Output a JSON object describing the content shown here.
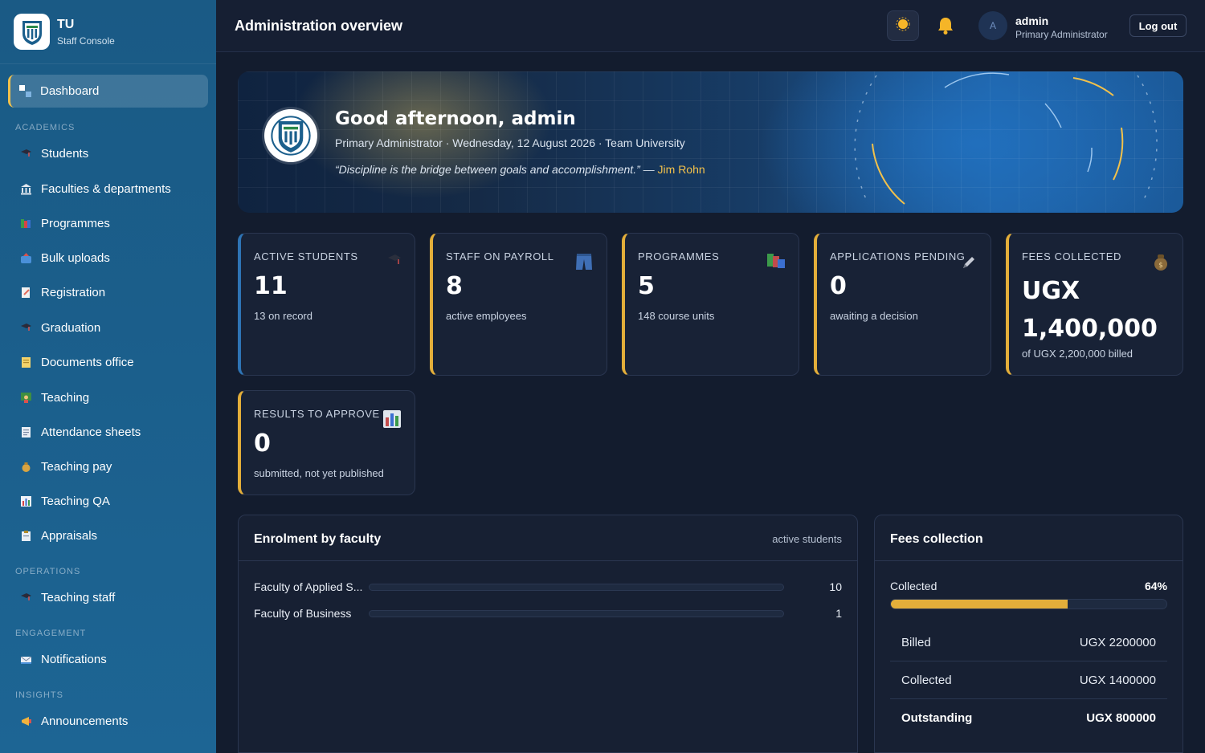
{
  "brand": {
    "name": "TU",
    "subtitle": "Staff Console"
  },
  "sidebar": {
    "active": {
      "label": "Dashboard",
      "icon": "dashboard-icon"
    },
    "sections": [
      {
        "title": "ACADEMICS",
        "items": [
          {
            "label": "Students",
            "icon": "graduation-cap-icon"
          },
          {
            "label": "Faculties & departments",
            "icon": "building-icon"
          },
          {
            "label": "Programmes",
            "icon": "books-icon"
          },
          {
            "label": "Bulk uploads",
            "icon": "upload-icon"
          },
          {
            "label": "Registration",
            "icon": "form-icon"
          },
          {
            "label": "Graduation",
            "icon": "graduation-cap-icon"
          },
          {
            "label": "Documents office",
            "icon": "document-icon"
          },
          {
            "label": "Teaching",
            "icon": "teacher-icon"
          },
          {
            "label": "Attendance sheets",
            "icon": "sheet-icon"
          },
          {
            "label": "Teaching pay",
            "icon": "money-bag-icon"
          },
          {
            "label": "Teaching QA",
            "icon": "chart-icon"
          },
          {
            "label": "Appraisals",
            "icon": "clipboard-icon"
          }
        ]
      },
      {
        "title": "OPERATIONS",
        "items": [
          {
            "label": "Teaching staff",
            "icon": "graduation-cap-icon"
          }
        ]
      },
      {
        "title": "ENGAGEMENT",
        "items": [
          {
            "label": "Notifications",
            "icon": "mail-icon"
          }
        ]
      },
      {
        "title": "INSIGHTS",
        "items": [
          {
            "label": "Announcements",
            "icon": "megaphone-icon"
          }
        ]
      }
    ]
  },
  "header": {
    "title": "Administration overview",
    "user": {
      "initial": "A",
      "name": "admin",
      "role": "Primary Administrator"
    },
    "logout_label": "Log out"
  },
  "hero": {
    "greeting": "Good afternoon, admin",
    "subtitle": "Primary Administrator · Wednesday, 12 August 2026 · Team University",
    "quote": "“Discipline is the bridge between goals and accomplishment.”",
    "quote_dash": " — ",
    "quote_author": "Jim Rohn"
  },
  "stats": [
    {
      "label": "ACTIVE STUDENTS",
      "value": "11",
      "note": "13 on record",
      "icon": "graduation-cap-icon",
      "accent": "#2e74b5"
    },
    {
      "label": "STAFF ON PAYROLL",
      "value": "8",
      "note": "active employees",
      "icon": "jeans-icon",
      "accent": "#e3ae3a"
    },
    {
      "label": "PROGRAMMES",
      "value": "5",
      "note": "148 course units",
      "icon": "books-icon",
      "accent": "#e3ae3a"
    },
    {
      "label": "APPLICATIONS PENDING",
      "value": "0",
      "note": "awaiting a decision",
      "icon": "pencil-icon",
      "accent": "#e3ae3a"
    },
    {
      "label": "FEES COLLECTED",
      "value": "UGX 1,400,000",
      "note": "of UGX 2,200,000 billed",
      "icon": "money-bag-icon",
      "accent": "#e3ae3a"
    },
    {
      "label": "RESULTS TO APPROVE",
      "value": "0",
      "note": "submitted, not yet published",
      "icon": "chart-icon",
      "accent": "#e3ae3a"
    }
  ],
  "enrolment": {
    "title": "Enrolment by faculty",
    "hint": "active students",
    "rows": [
      {
        "name": "Faculty of Applied S...",
        "count": "10",
        "fraction": 0
      },
      {
        "name": "Faculty of Business",
        "count": "1",
        "fraction": 0
      }
    ]
  },
  "fees": {
    "title": "Fees collection",
    "collected_label": "Collected",
    "collected_pct": "64%",
    "progress": 0.64,
    "rows": [
      {
        "label": "Billed",
        "value": "UGX 2200000"
      },
      {
        "label": "Collected",
        "value": "UGX 1400000"
      },
      {
        "label": "Outstanding",
        "value": "UGX 800000"
      }
    ]
  },
  "colors": {
    "accent_gold": "#e3ae3a",
    "accent_blue": "#2e74b5",
    "sidebar": "#1b5f8c"
  }
}
